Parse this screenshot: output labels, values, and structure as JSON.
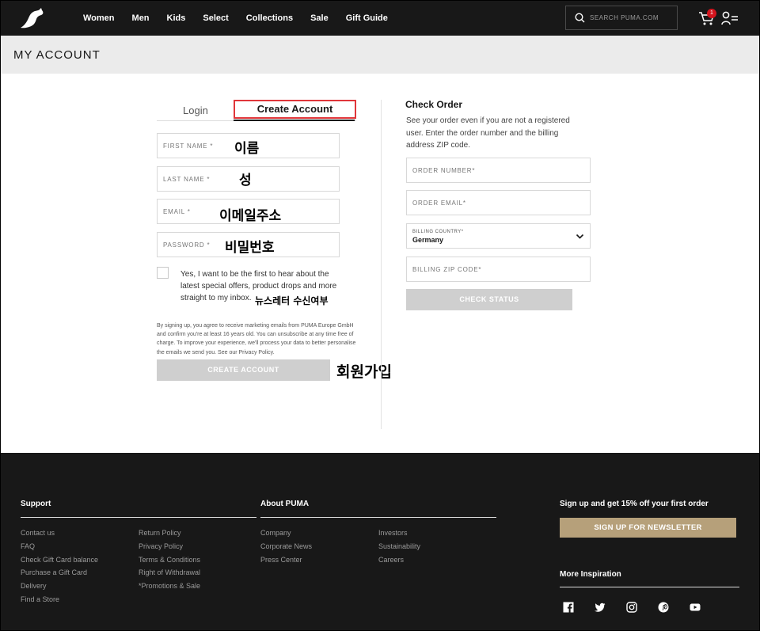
{
  "nav": {
    "items": [
      "Women",
      "Men",
      "Kids",
      "Select",
      "Collections",
      "Sale",
      "Gift Guide"
    ],
    "search_placeholder": "SEARCH PUMA.COM",
    "cart_count": "1"
  },
  "page": {
    "title": "MY ACCOUNT"
  },
  "tabs": {
    "login": "Login",
    "create": "Create Account"
  },
  "form": {
    "first_name": "FIRST NAME *",
    "last_name": "LAST NAME *",
    "email": "EMAIL *",
    "password": "PASSWORD *",
    "optin": "Yes, I want to be the first to hear about the latest special offers, product drops and more straight to my inbox.",
    "legal": "By signing up, you agree to receive marketing emails from PUMA Europe GmbH and confirm you're at least 16 years old. You can unsubscribe at any time free of charge. To improve your experience, we'll process your data to better personalise the emails we send you. See our Privacy Policy.",
    "submit": "CREATE ACCOUNT"
  },
  "annotations": {
    "first_name": "이름",
    "last_name": "성",
    "email": "이메일주소",
    "password": "비밀번호",
    "newsletter": "뉴스레터 수신여부",
    "signup": "회원가입"
  },
  "check_order": {
    "title": "Check Order",
    "description": "See your order even if you are not a registered user. Enter the order number and the billing address ZIP code.",
    "order_number": "ORDER NUMBER*",
    "order_email": "ORDER EMAIL*",
    "billing_country_label": "BILLING COUNTRY*",
    "billing_country_value": "Germany",
    "billing_zip": "BILLING ZIP CODE*",
    "submit": "CHECK STATUS"
  },
  "footer": {
    "support_title": "Support",
    "support_col1": [
      "Contact us",
      "FAQ",
      "Check Gift Card balance",
      "Purchase a Gift Card",
      "Delivery",
      "Find a Store"
    ],
    "support_col2": [
      "Return Policy",
      "Privacy Policy",
      "Terms & Conditions",
      "Right of Withdrawal",
      "*Promotions & Sale"
    ],
    "about_title": "About PUMA",
    "about_col1": [
      "Company",
      "Corporate News",
      "Press Center"
    ],
    "about_col2": [
      "Investors",
      "Sustainability",
      "Careers"
    ],
    "signup_title": "Sign up and get 15% off your first order",
    "signup_button": "SIGN UP FOR NEWSLETTER",
    "inspiration_title": "More Inspiration",
    "social": [
      "facebook-icon",
      "twitter-icon",
      "instagram-icon",
      "pinterest-icon",
      "youtube-icon"
    ]
  },
  "colors": {
    "header_bg": "#181818",
    "highlight_border": "#e0363a",
    "badge": "#d4151e",
    "newsletter_button": "#b6a07a",
    "disabled_button": "#cfcfcf"
  }
}
